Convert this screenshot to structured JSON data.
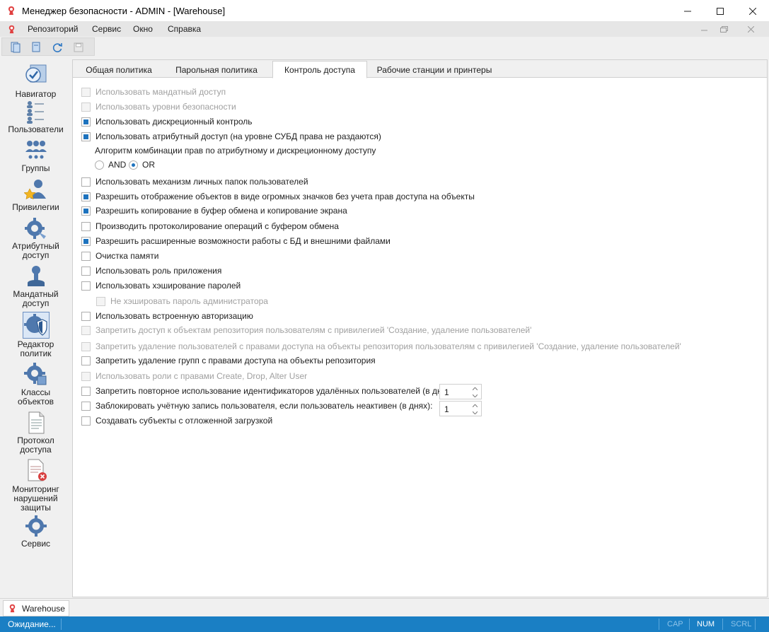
{
  "window": {
    "title": "Менеджер безопасности - ADMIN - [Warehouse]"
  },
  "menu": {
    "items": [
      "Репозиторий",
      "Сервис",
      "Окно",
      "Справка"
    ]
  },
  "nav": {
    "items": [
      {
        "label": "Навигатор",
        "icon": "navigator-icon"
      },
      {
        "label": "Пользователи",
        "icon": "users-icon"
      },
      {
        "label": "Группы",
        "icon": "groups-icon"
      },
      {
        "label": "Привилегии",
        "icon": "privileges-icon"
      },
      {
        "label_lines": [
          "Атрибутный",
          "доступ"
        ],
        "icon": "attribute-access-icon"
      },
      {
        "label_lines": [
          "Мандатный",
          "доступ"
        ],
        "icon": "mandatory-access-icon"
      },
      {
        "label_lines": [
          "Редактор",
          "политик"
        ],
        "icon": "policy-editor-icon",
        "selected": true
      },
      {
        "label_lines": [
          "Классы",
          "объектов"
        ],
        "icon": "object-classes-icon"
      },
      {
        "label_lines": [
          "Протокол",
          "доступа"
        ],
        "icon": "access-log-icon"
      },
      {
        "label_lines": [
          "Мониторинг",
          "нарушений",
          "защиты"
        ],
        "icon": "violation-monitoring-icon"
      },
      {
        "label": "Сервис",
        "icon": "service-icon"
      }
    ]
  },
  "tabs": {
    "items": [
      "Общая политика",
      "Парольная политика",
      "Контроль доступа",
      "Рабочие станции и принтеры"
    ],
    "active": 2
  },
  "options": [
    {
      "label": "Использовать мандатный доступ",
      "checked": false,
      "disabled": true
    },
    {
      "label": "Использовать уровни безопасности",
      "checked": false,
      "disabled": true
    },
    {
      "label": "Использовать дискреционный контроль",
      "checked": true,
      "disabled": false
    },
    {
      "label": "Использовать атрибутный доступ (на уровне СУБД права не раздаются)",
      "checked": true,
      "disabled": false
    },
    {
      "label": "Использовать механизм личных папок пользователей",
      "checked": false,
      "disabled": false
    },
    {
      "label": "Разрешить отображение объектов в виде огромных значков без учета прав доступа на объекты",
      "checked": true,
      "disabled": false
    },
    {
      "label": "Разрешить копирование в буфер обмена и копирование экрана",
      "checked": true,
      "disabled": false
    },
    {
      "label": "Производить протоколирование операций с буфером обмена",
      "checked": false,
      "disabled": false
    },
    {
      "label": "Разрешить расширенные возможности работы с БД и внешними файлами",
      "checked": true,
      "disabled": false
    },
    {
      "label": "Очистка памяти",
      "checked": false,
      "disabled": false
    },
    {
      "label": "Использовать роль приложения",
      "checked": false,
      "disabled": false
    },
    {
      "label": "Использовать хэширование паролей",
      "checked": false,
      "disabled": false
    },
    {
      "label": "Не хэшировать пароль администратора",
      "checked": false,
      "disabled": true
    },
    {
      "label": "Использовать встроенную авторизацию",
      "checked": false,
      "disabled": false
    },
    {
      "label": "Запретить доступ к объектам репозитория пользователям с привилегией 'Создание, удаление пользователей'",
      "checked": false,
      "disabled": true
    },
    {
      "label": "Запретить удаление пользователей с правами доступа на объекты репозитория пользователям с привилегией 'Создание, удаление пользователей'",
      "checked": false,
      "disabled": true
    },
    {
      "label": "Запретить удаление групп с правами доступа на объекты репозитория",
      "checked": false,
      "disabled": false
    },
    {
      "label": "Использовать роли с правами Create, Drop, Alter User",
      "checked": false,
      "disabled": true
    },
    {
      "label": "Запретить повторное использование идентификаторов удалённых пользователей (в днях):",
      "checked": false,
      "disabled": false
    },
    {
      "label": "Заблокировать учётную запись пользователя, если пользователь неактивен (в днях):",
      "checked": false,
      "disabled": false
    },
    {
      "label": "Создавать субъекты с отложенной загрузкой",
      "checked": false,
      "disabled": false
    }
  ],
  "combination": {
    "caption": "Алгоритм комбинации прав по атрибутному и дискреционному доступу",
    "and_label": "AND",
    "or_label": "OR",
    "selected": "OR"
  },
  "spinners": {
    "reuse_days": "1",
    "inactive_days": "1"
  },
  "doc_tab": {
    "label": "Warehouse"
  },
  "status": {
    "text": "Ожидание...",
    "cap": "CAP",
    "num": "NUM",
    "scrl": "SCRL"
  },
  "colors": {
    "accent": "#1e73be",
    "statusbar": "#1a7fc4"
  }
}
